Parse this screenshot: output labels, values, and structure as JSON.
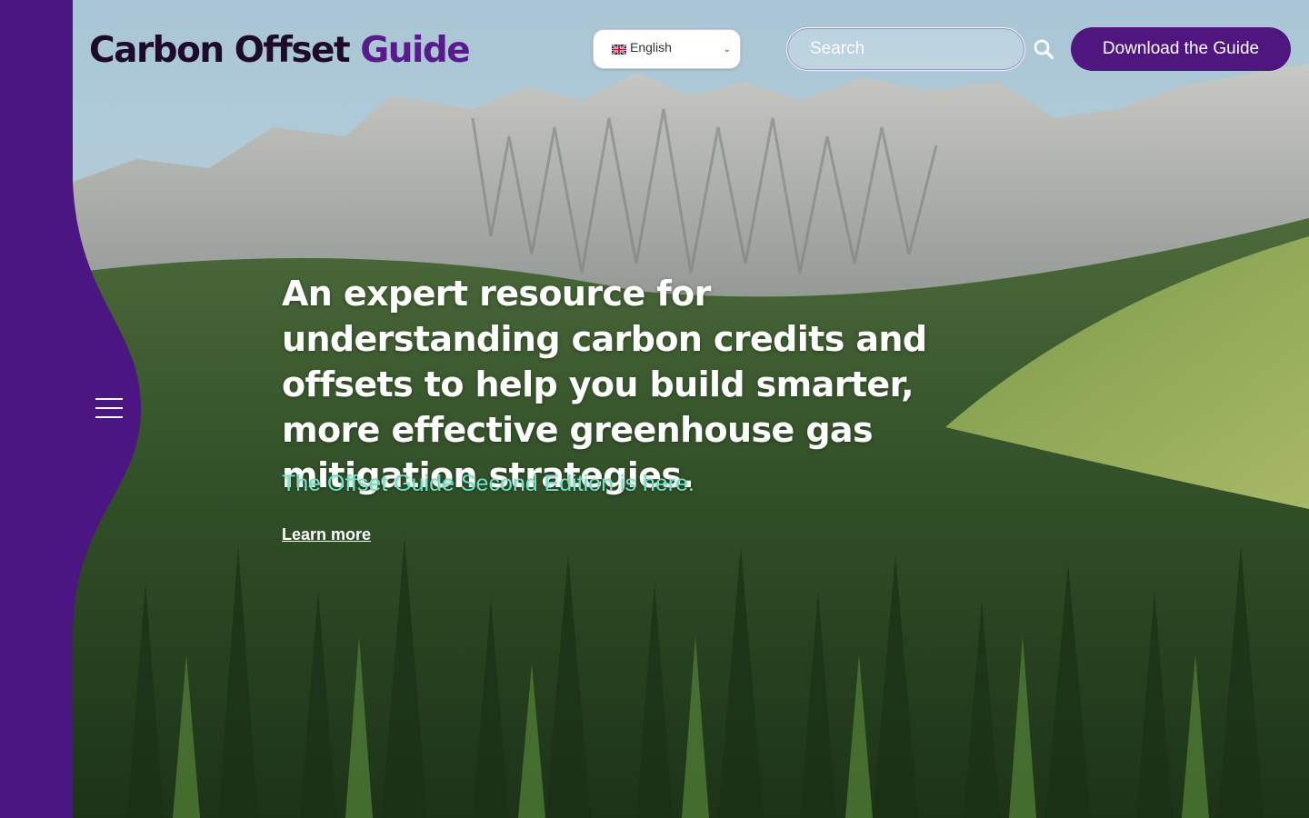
{
  "header": {
    "logo_primary": "Carbon Offset",
    "logo_accent": "Guide",
    "language": {
      "selected": "English",
      "flag_icon": "uk-flag-icon"
    },
    "search": {
      "placeholder": "Search",
      "icon": "search-icon"
    },
    "download_label": "Download the Guide"
  },
  "sidebar": {
    "menu_icon": "hamburger-menu-icon"
  },
  "hero": {
    "headline": "An expert resource for understanding carbon credits and offsets to help you build smarter, more effective greenhouse gas mitigation strategies.",
    "subheadline": "The Offset Guide Second Edition is here.",
    "cta_label": "Learn more"
  },
  "colors": {
    "brand_purple": "#4f1680",
    "sidebar_purple": "#4b1682",
    "accent_teal": "#6fe0c4"
  }
}
